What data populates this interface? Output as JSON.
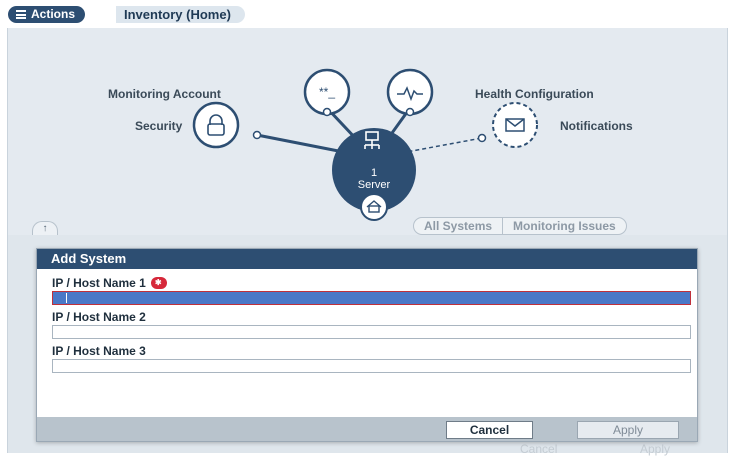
{
  "header": {
    "actions_label": "Actions",
    "title": "Inventory (Home)"
  },
  "diagram": {
    "nodes": {
      "monitoring_account": "Monitoring Account",
      "health_configuration": "Health Configuration",
      "security": "Security",
      "notifications": "Notifications"
    },
    "server_count": "1",
    "server_label": "Server",
    "icons": {
      "monitoring_account": "password-dots-icon",
      "health_configuration": "heartbeat-icon",
      "security": "lock-icon",
      "notifications": "envelope-icon",
      "server": "network-server-icon",
      "home": "home-icon"
    }
  },
  "view_tabs": [
    "All Systems",
    "Monitoring Issues"
  ],
  "collapse_icon": "up-arrow-icon",
  "dialog": {
    "title": "Add System",
    "fields": [
      {
        "label": "IP / Host Name 1",
        "value": "",
        "required": true
      },
      {
        "label": "IP / Host Name 2",
        "value": ""
      },
      {
        "label": "IP / Host Name 3",
        "value": ""
      }
    ],
    "cancel_label": "Cancel",
    "apply_label": "Apply"
  },
  "background_buttons": {
    "cancel": "Cancel",
    "apply": "Apply"
  },
  "colors": {
    "header_blue": "#2d4e72",
    "active_field": "#4a78c7",
    "required_red": "#d6283a"
  }
}
